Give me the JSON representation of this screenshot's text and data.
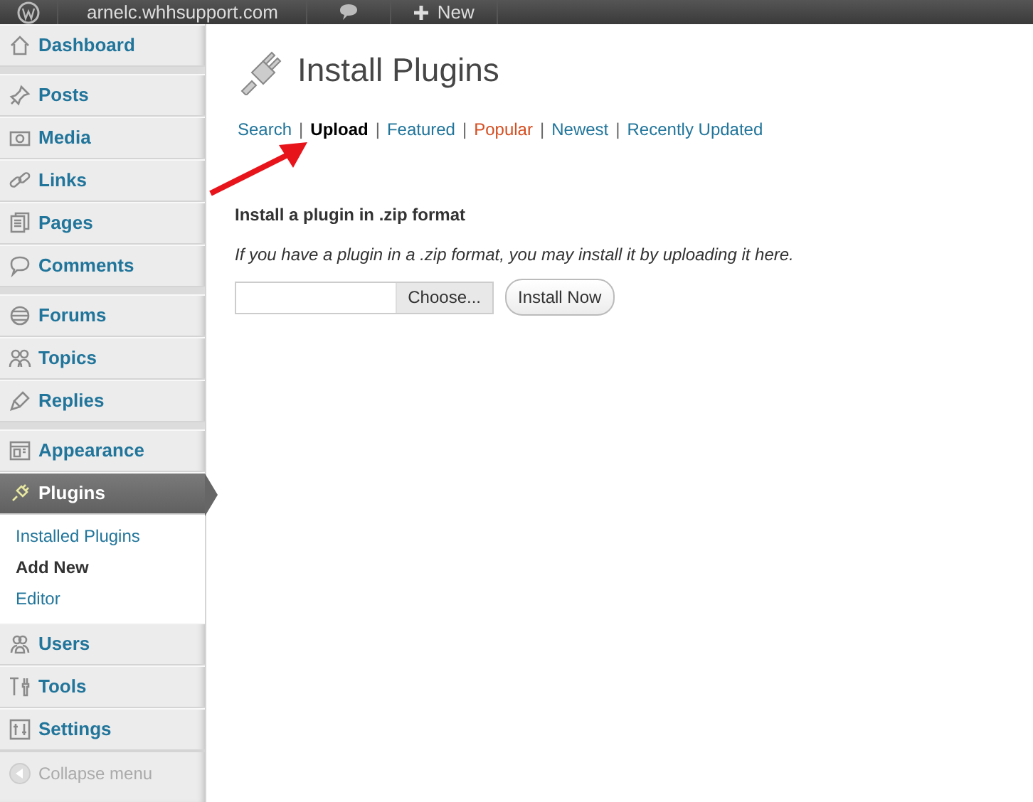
{
  "admin_bar": {
    "site_name": "arnelc.whhsupport.com",
    "new_label": "New"
  },
  "sidebar": {
    "groups": [
      [
        {
          "label": "Dashboard",
          "selected": false
        }
      ],
      [
        {
          "label": "Posts",
          "selected": false
        },
        {
          "label": "Media",
          "selected": false
        },
        {
          "label": "Links",
          "selected": false
        },
        {
          "label": "Pages",
          "selected": false
        },
        {
          "label": "Comments",
          "selected": false
        }
      ],
      [
        {
          "label": "Forums",
          "selected": false
        },
        {
          "label": "Topics",
          "selected": false
        },
        {
          "label": "Replies",
          "selected": false
        }
      ],
      [
        {
          "label": "Appearance",
          "selected": false
        },
        {
          "label": "Plugins",
          "selected": true,
          "children": [
            {
              "label": "Installed Plugins",
              "selected": false
            },
            {
              "label": "Add New",
              "selected": true
            },
            {
              "label": "Editor",
              "selected": false
            }
          ]
        },
        {
          "label": "Users",
          "selected": false
        },
        {
          "label": "Tools",
          "selected": false
        },
        {
          "label": "Settings",
          "selected": false
        }
      ]
    ],
    "collapse_label": "Collapse menu"
  },
  "page": {
    "title": "Install Plugins",
    "tabs": [
      {
        "label": "Search",
        "selected": false,
        "color": "#21759b",
        "separator": "|"
      },
      {
        "label": "Upload",
        "selected": true,
        "color": "#000000",
        "separator": "|"
      },
      {
        "label": "Featured",
        "selected": false,
        "color": "#21759b",
        "separator": "|"
      },
      {
        "label": "Popular",
        "selected": false,
        "color": "#d54e21",
        "separator": "|"
      },
      {
        "label": "Newest",
        "selected": false,
        "color": "#21759b",
        "separator": "|"
      },
      {
        "label": "Recently Updated",
        "selected": false,
        "color": "#21759b"
      }
    ],
    "section_heading": "Install a plugin in .zip format",
    "description": "If you have a plugin in a .zip format, you may install it by uploading it here.",
    "file_button": "Choose...",
    "submit_button": "Install Now"
  }
}
